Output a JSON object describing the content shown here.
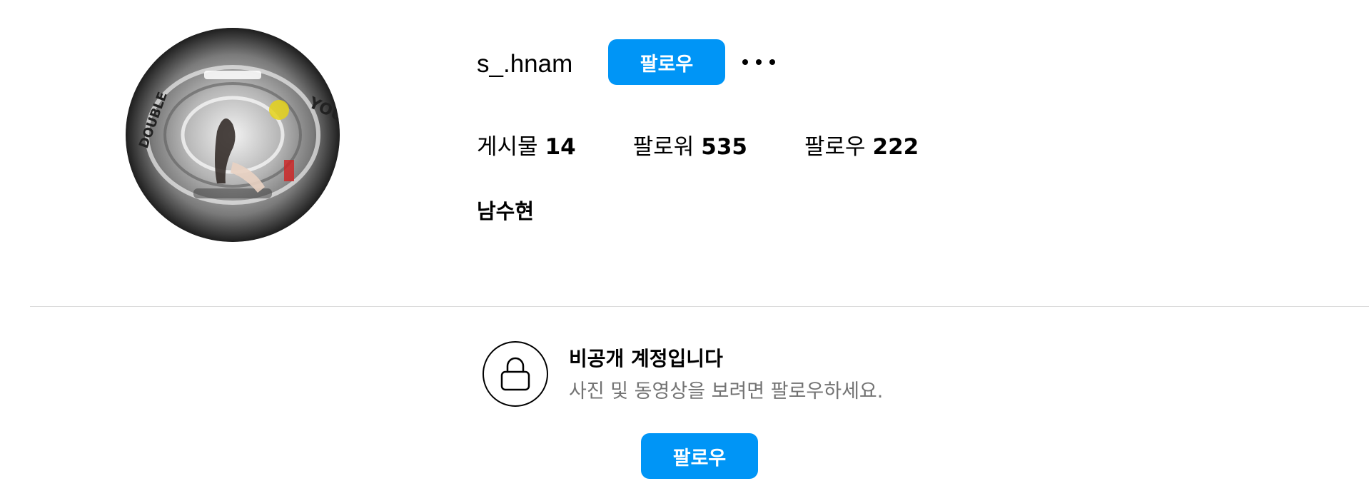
{
  "profile": {
    "username": "s_.hnam",
    "follow_label": "팔로우",
    "more_icon": "more-horizontal-icon",
    "full_name": "남수현",
    "avatar_icon": "profile-photo"
  },
  "stats": [
    {
      "label": "게시물",
      "value": "14"
    },
    {
      "label": "팔로워",
      "value": "535"
    },
    {
      "label": "팔로우",
      "value": "222"
    }
  ],
  "private_notice": {
    "icon": "lock-icon",
    "title": "비공개 계정입니다",
    "subtitle": "사진 및 동영상을 보려면 팔로우하세요.",
    "follow_label": "팔로우"
  },
  "colors": {
    "accent": "#0095f6",
    "secondary_text": "#737373",
    "divider": "#dbdbdb"
  }
}
